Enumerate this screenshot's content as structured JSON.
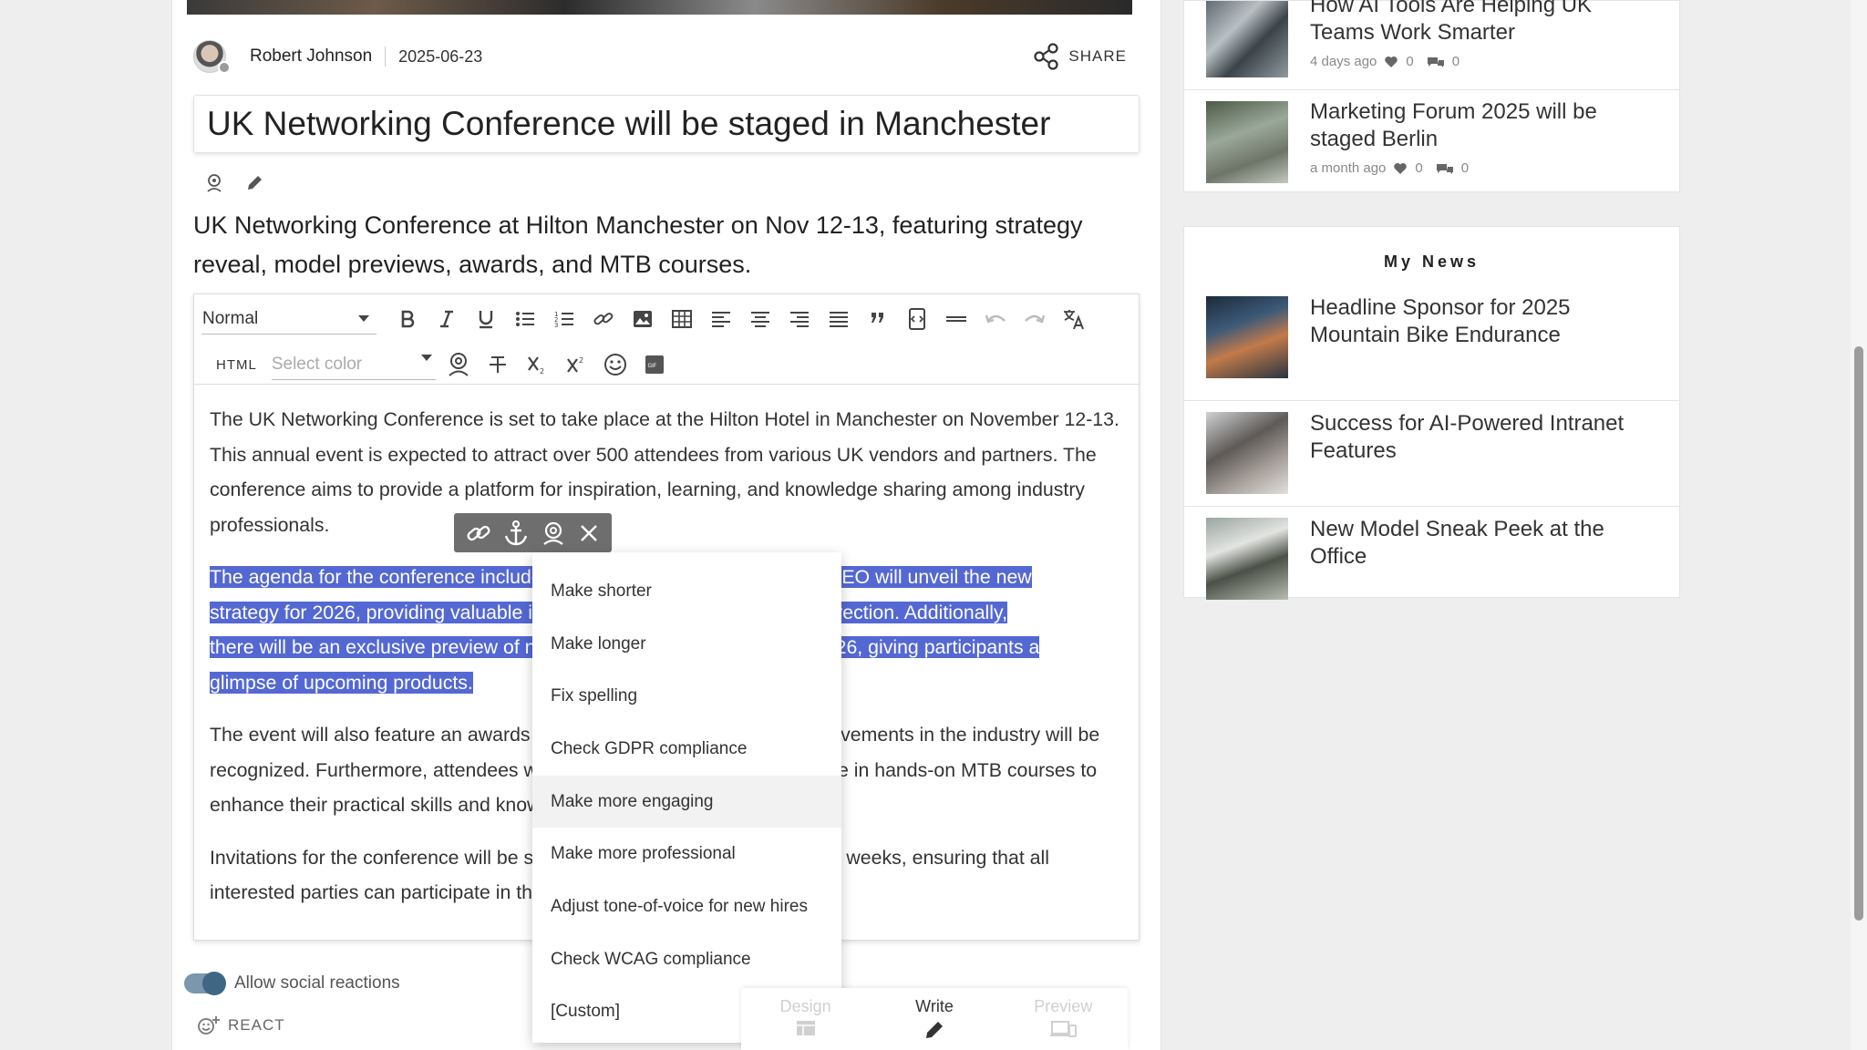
{
  "article": {
    "author": "Robert Johnson",
    "date": "2025-06-23",
    "share_label": "SHARE",
    "title": "UK Networking Conference will be staged in Manchester",
    "lead": "UK Networking Conference at Hilton Manchester on Nov 12-13, featuring strategy reveal, model previews, awards, and MTB courses.",
    "paragraphs": {
      "p1": "The UK Networking Conference is set to take place at the Hilton Hotel in Manchester on November 12-13. This annual event is expected to attract over 500 attendees from various UK vendors and partners. The conference aims to provide a platform for inspiration, learning, and knowledge sharing among industry professionals.",
      "p2_l1": "The agenda for the conference includes several exciting highlights. The CEO will unveil the new",
      "p2_l2": "strategy for 2026, providing valuable insights into the company's future direction. Additionally,",
      "p2_l3": "there will be an exclusive preview of new models set to be released in 2026, giving participants a",
      "p2_l4": "glimpse of upcoming products.",
      "p3": "The event will also feature an awards ceremony, where outstanding achievements in the industry will be recognized. Furthermore, attendees will have the opportunity to participate in hands-on MTB courses to enhance their practical skills and knowledge.",
      "p4": "Invitations for the conference will be sent across the UK over the next two weeks, ensuring that all interested parties can participate in this significant event."
    }
  },
  "editor": {
    "format_value": "Normal",
    "html_label": "HTML",
    "color_placeholder": "Select color"
  },
  "ai_menu": {
    "items": [
      "Make shorter",
      "Make longer",
      "Fix spelling",
      "Check GDPR compliance",
      "Make more engaging",
      "Make more professional",
      "Adjust tone-of-voice for new hires",
      "Check WCAG compliance",
      "[Custom]"
    ],
    "highlighted_index": 4
  },
  "footer": {
    "allow_social_label": "Allow social reactions",
    "react_label": "REACT",
    "modes": [
      "Design",
      "Write",
      "Preview"
    ],
    "active_mode": "Write"
  },
  "sidebar": {
    "top_news": [
      {
        "title": "How AI Tools Are Helping UK Teams Work Smarter",
        "time": "4 days ago",
        "likes": "0",
        "comments": "0"
      },
      {
        "title": "Marketing Forum 2025 will be staged Berlin",
        "time": "a month ago",
        "likes": "0",
        "comments": "0"
      }
    ],
    "my_news_title": "My News",
    "my_news": [
      {
        "title": "Headline Sponsor for 2025 Mountain Bike Endurance"
      },
      {
        "title": "Success for AI-Powered Intranet Features"
      },
      {
        "title": "New Model Sneak Peek at the Office"
      }
    ]
  },
  "colors": {
    "selection": "#5468d4",
    "toggle": "#3f6783"
  }
}
